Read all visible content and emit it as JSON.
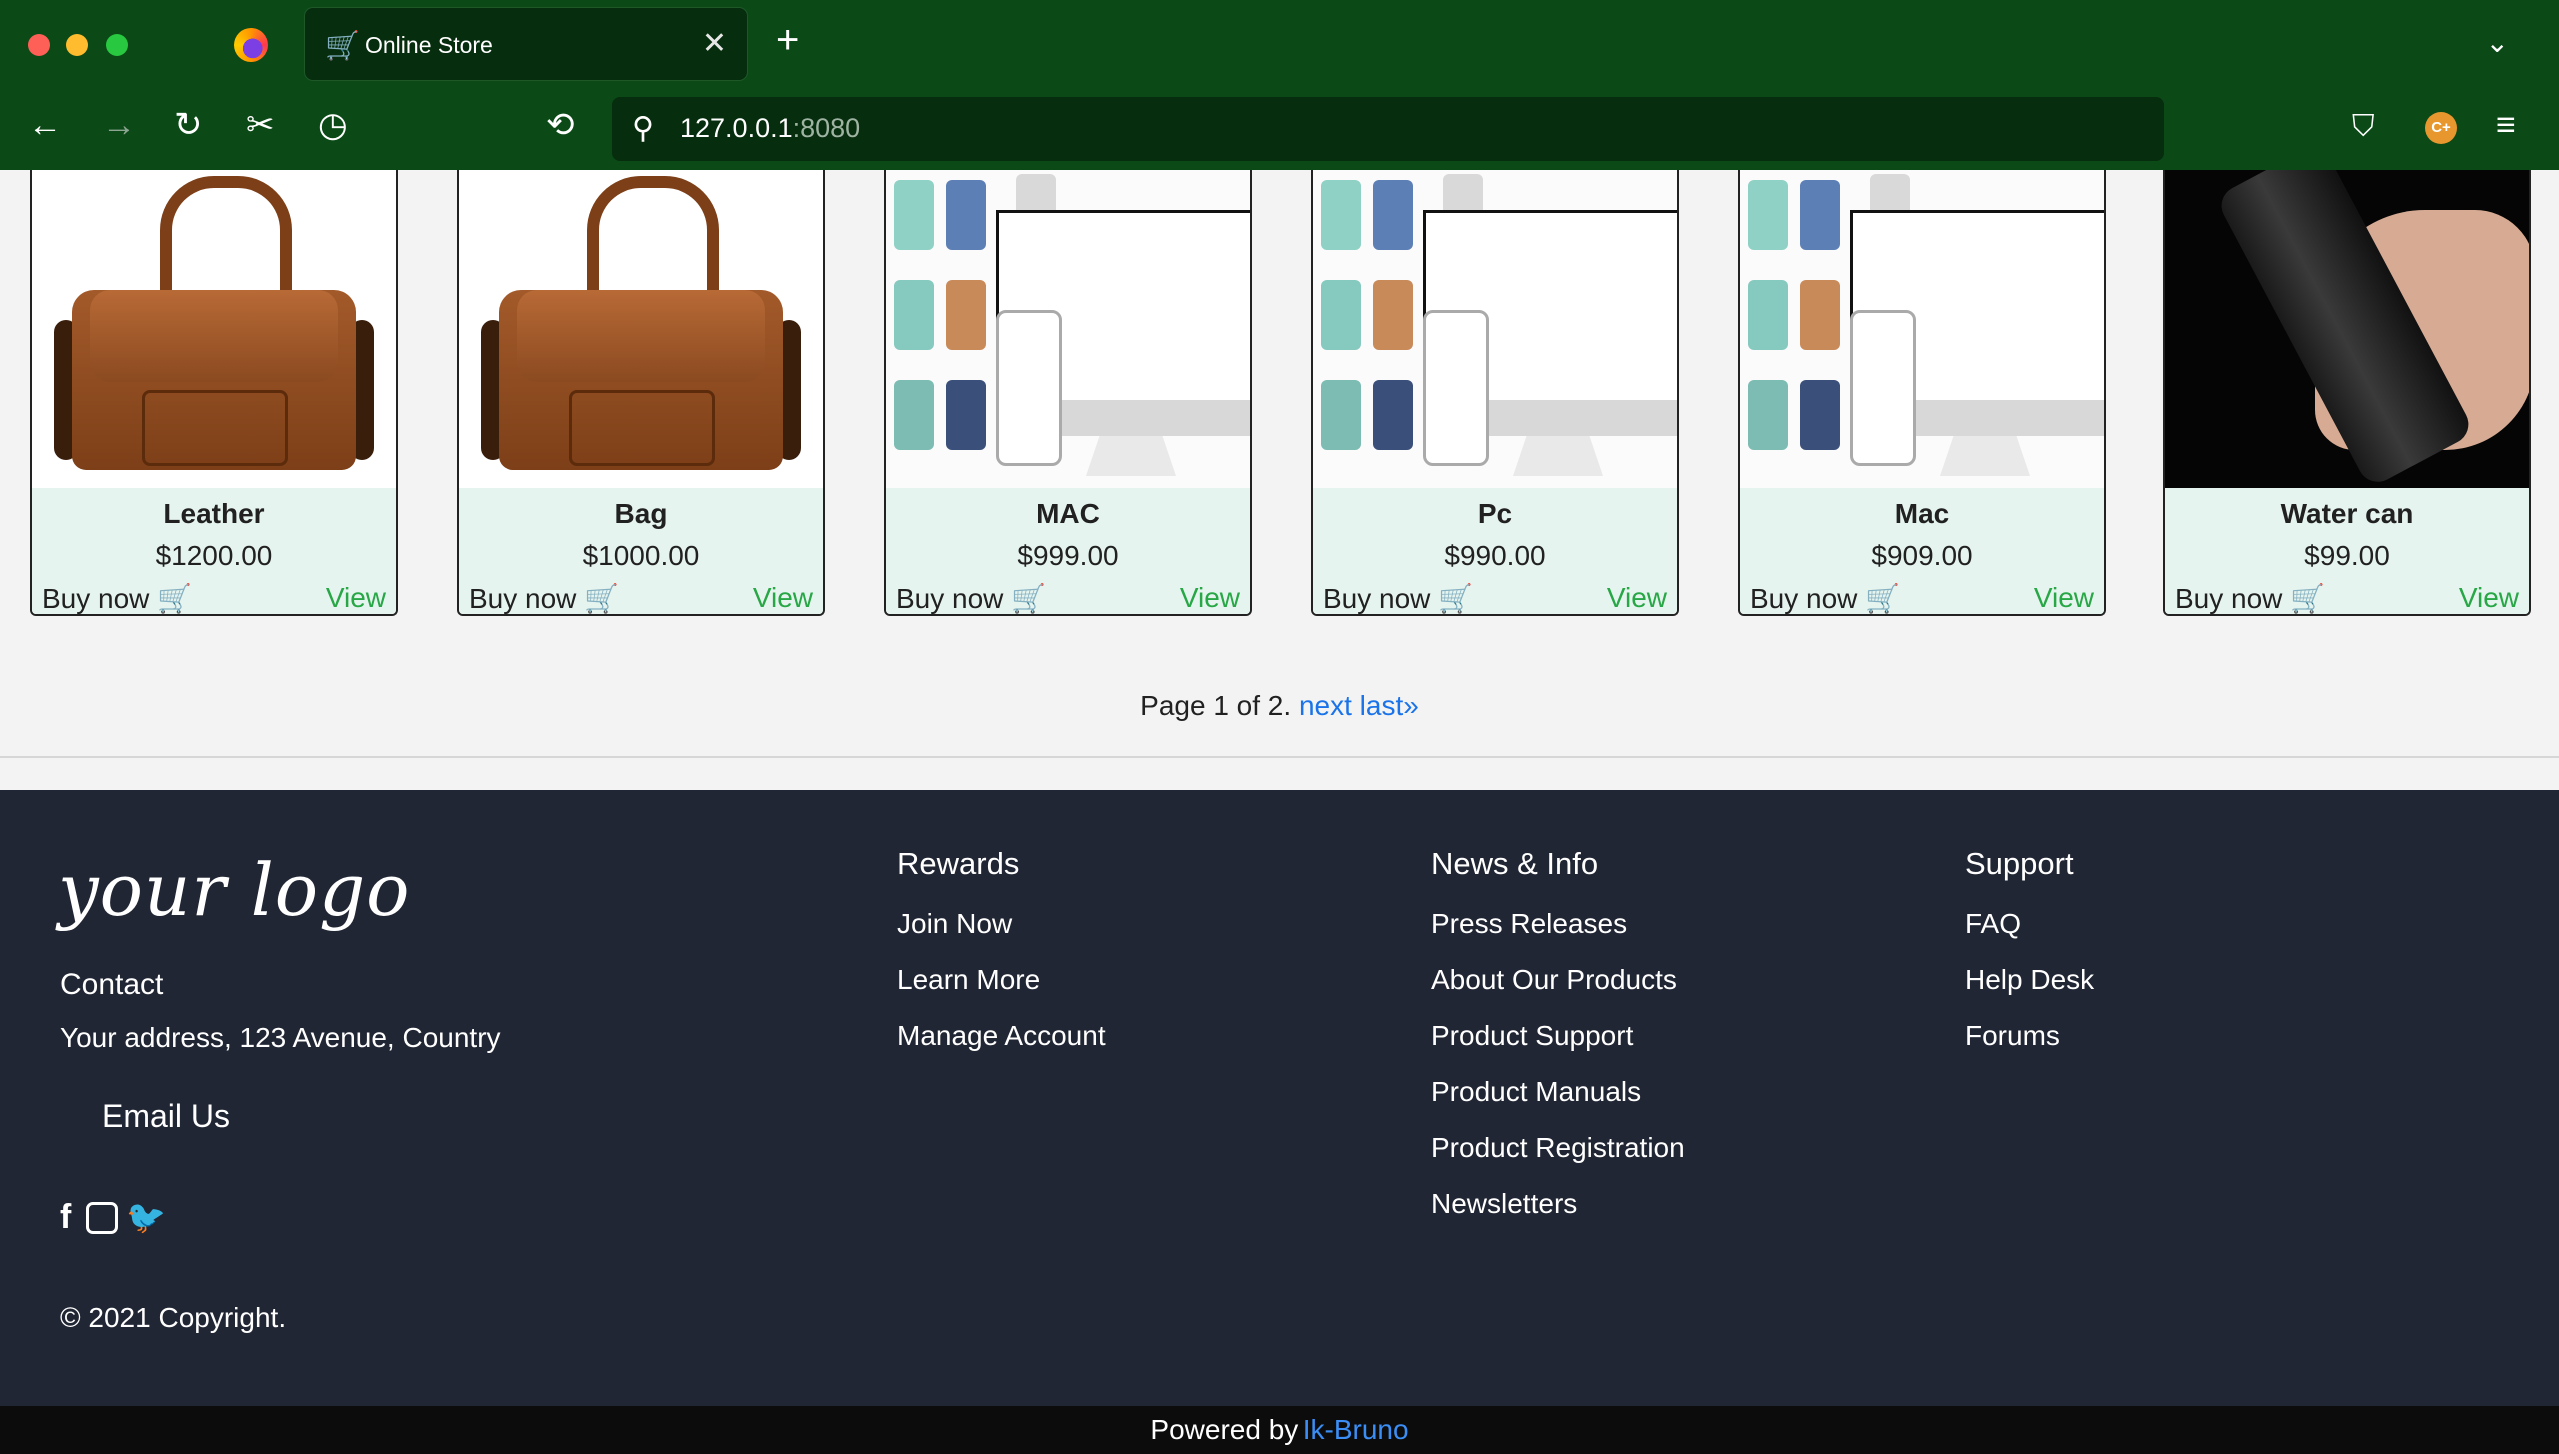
{
  "browser": {
    "tab_title": "Online Store",
    "url_host": "127.0.0.1",
    "url_port": ":8080",
    "account_initials": "C+"
  },
  "products": [
    {
      "name": "Leather",
      "price": "$1200.00",
      "buy_label": "Buy now 🛒",
      "view_label": "View",
      "image": "leather-bag"
    },
    {
      "name": "Bag",
      "price": "$1000.00",
      "buy_label": "Buy now 🛒",
      "view_label": "View",
      "image": "leather-bag"
    },
    {
      "name": "MAC",
      "price": "$999.00",
      "buy_label": "Buy now 🛒",
      "view_label": "View",
      "image": "store-mockup"
    },
    {
      "name": "Pc",
      "price": "$990.00",
      "buy_label": "Buy now 🛒",
      "view_label": "View",
      "image": "store-mockup"
    },
    {
      "name": "Mac",
      "price": "$909.00",
      "buy_label": "Buy now 🛒",
      "view_label": "View",
      "image": "store-mockup"
    },
    {
      "name": "Water can",
      "price": "$99.00",
      "buy_label": "Buy now 🛒",
      "view_label": "View",
      "image": "water-can"
    }
  ],
  "pagination": {
    "status": "Page 1 of 2.",
    "next": "next",
    "last": "last»"
  },
  "footer": {
    "logo": "your logo",
    "contact_heading": "Contact",
    "address": "Your address, 123 Avenue, Country",
    "email_label": "Email Us",
    "copyright": "© 2021 Copyright.",
    "columns": [
      {
        "heading": "Rewards",
        "links": [
          "Join Now",
          "Learn More",
          "Manage Account"
        ]
      },
      {
        "heading": "News & Info",
        "links": [
          "Press Releases",
          "About Our Products",
          "Product Support",
          "Product Manuals",
          "Product Registration",
          "Newsletters"
        ]
      },
      {
        "heading": "Support",
        "links": [
          "FAQ",
          "Help Desk",
          "Forums"
        ]
      }
    ],
    "powered_by": "Powered by",
    "powered_by_link": "Ik-Bruno"
  }
}
